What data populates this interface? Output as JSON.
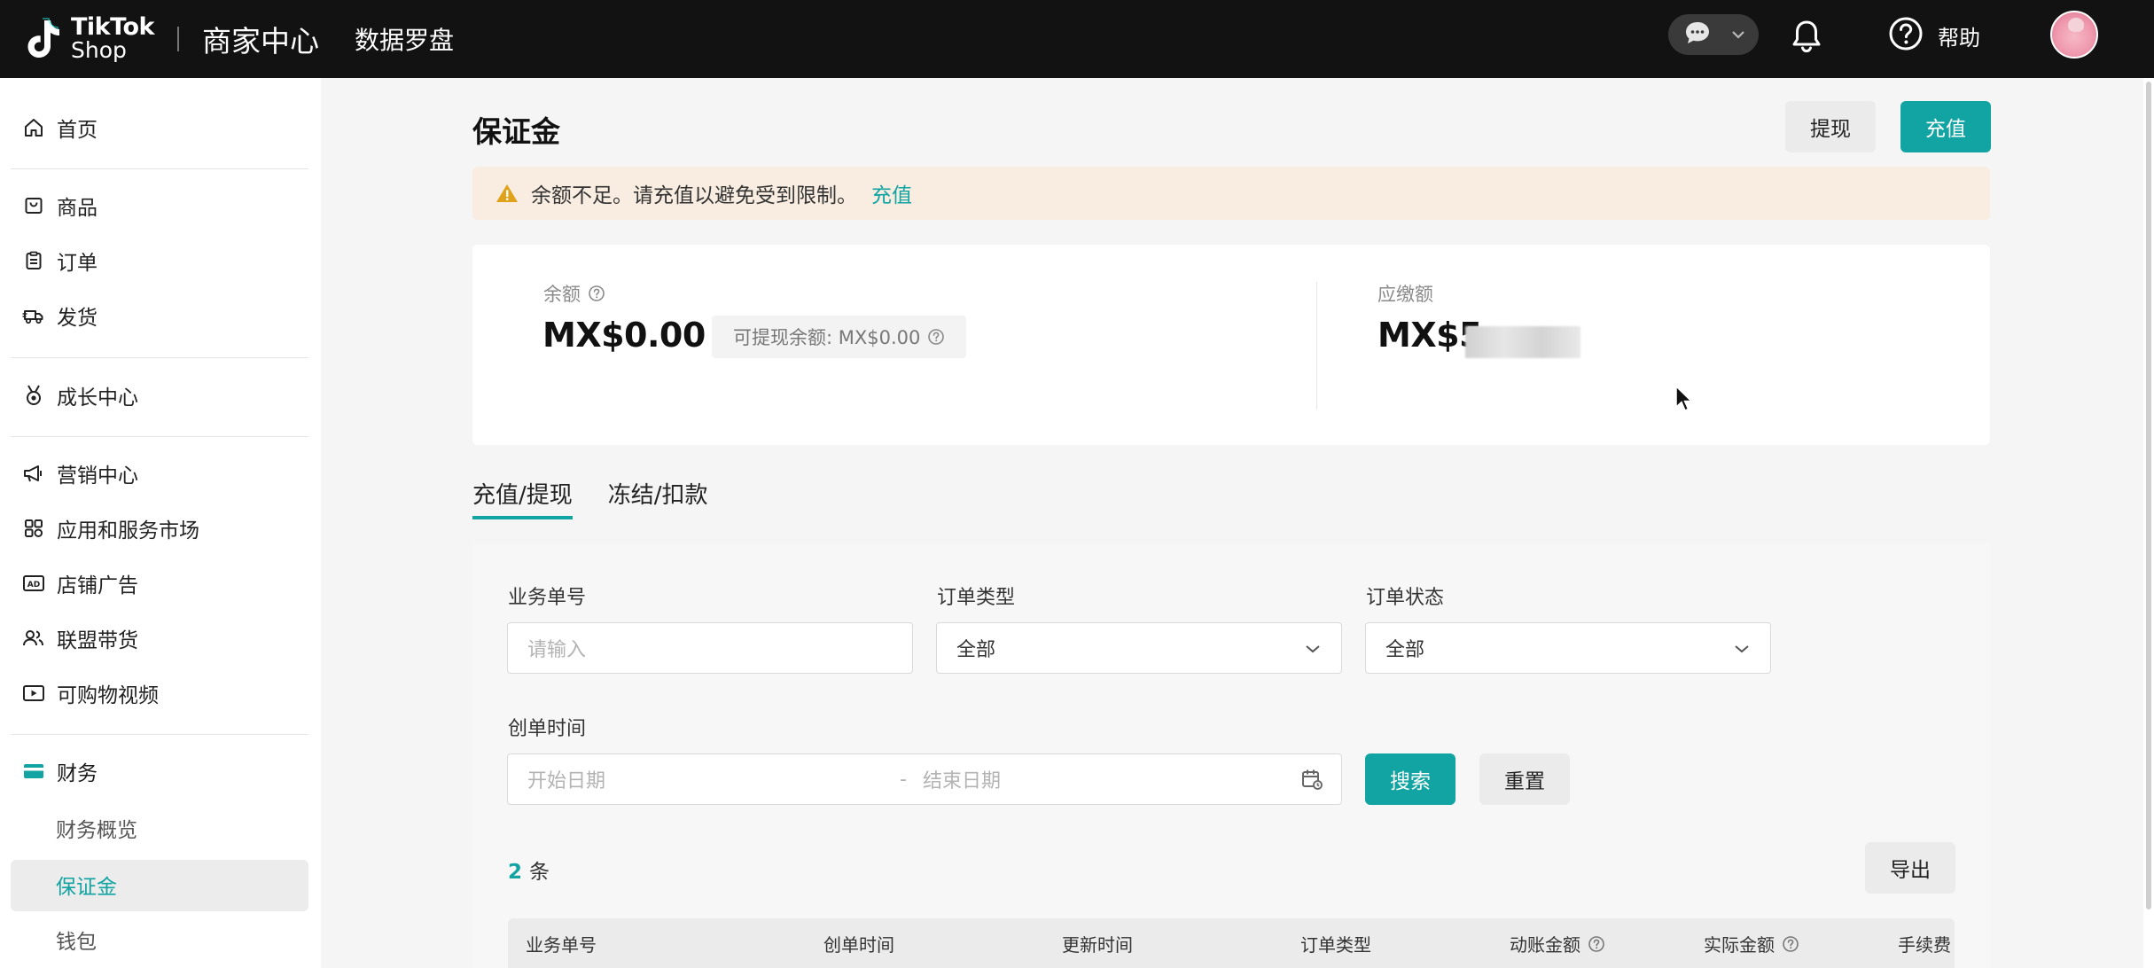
{
  "topbar": {
    "logo_line1": "TikTok",
    "logo_line2": "Shop",
    "title": "商家中心",
    "subtitle": "数据罗盘",
    "help_label": "帮助"
  },
  "sidebar": {
    "items": [
      {
        "label": "首页",
        "icon": "home-icon"
      },
      {
        "label": "商品",
        "icon": "product-icon"
      },
      {
        "label": "订单",
        "icon": "clipboard-icon"
      },
      {
        "label": "发货",
        "icon": "truck-icon"
      },
      {
        "label": "成长中心",
        "icon": "medal-icon"
      },
      {
        "label": "营销中心",
        "icon": "megaphone-icon"
      },
      {
        "label": "应用和服务市场",
        "icon": "apps-icon"
      },
      {
        "label": "店铺广告",
        "icon": "ad-icon"
      },
      {
        "label": "联盟带货",
        "icon": "affiliate-icon"
      },
      {
        "label": "可购物视频",
        "icon": "video-icon"
      },
      {
        "label": "财务",
        "icon": "wallet-card-icon"
      }
    ],
    "sub_items": [
      {
        "label": "财务概览"
      },
      {
        "label": "保证金"
      },
      {
        "label": "钱包"
      }
    ]
  },
  "main": {
    "title": "保证金",
    "withdraw_button": "提现",
    "recharge_button": "充值",
    "alert": {
      "text": "余额不足。请充值以避免受到限制。",
      "link": "充值"
    },
    "balance": {
      "label": "余额",
      "value": "MX$0.00",
      "withdrawable": "可提现余额: MX$0.00"
    },
    "due": {
      "label": "应缴额",
      "value_visible": "MX$5"
    },
    "tabs": [
      "充值/提现",
      "冻结/扣款"
    ],
    "filters": {
      "business_no_label": "业务单号",
      "business_no_placeholder": "请输入",
      "order_type_label": "订单类型",
      "order_type_value": "全部",
      "order_status_label": "订单状态",
      "order_status_value": "全部",
      "created_time_label": "创单时间",
      "start_placeholder": "开始日期",
      "range_sep": "-",
      "end_placeholder": "结束日期",
      "search_button": "搜索",
      "reset_button": "重置"
    },
    "result": {
      "count": "2",
      "unit": "条",
      "export_button": "导出"
    },
    "table": {
      "columns": [
        "业务单号",
        "创单时间",
        "更新时间",
        "订单类型",
        "动账金额",
        "实际金额",
        "手续费"
      ]
    }
  },
  "colors": {
    "accent": "#12a4a3",
    "topbar": "#121212",
    "alert_bg": "#f8ede0",
    "warning": "#e0a21b"
  }
}
